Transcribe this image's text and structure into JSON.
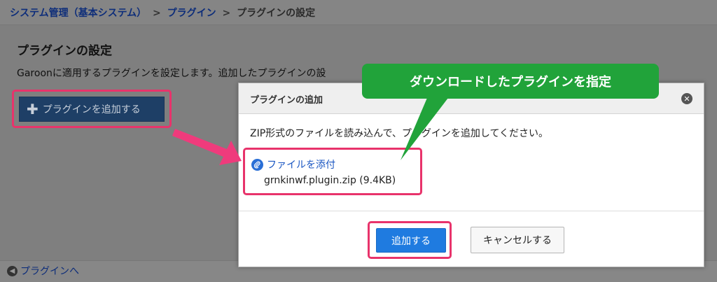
{
  "breadcrumb": {
    "item1": "システム管理（基本システム）",
    "sep": ">",
    "item2": "プラグイン",
    "current": "プラグインの設定"
  },
  "page": {
    "title": "プラグインの設定",
    "description": "Garoonに適用するプラグインを設定します。追加したプラグインの設",
    "add_button_label": "プラグインを追加する",
    "back_link_label": "プラグインへ"
  },
  "dialog": {
    "title": "プラグインの追加",
    "message": "ZIP形式のファイルを読み込んで、プラグインを追加してください。",
    "attach_label": "ファイルを添付",
    "file_name": "grnkinwf.plugin.zip (9.4KB)",
    "submit_label": "追加する",
    "cancel_label": "キャンセルする"
  },
  "annotation": {
    "callout_text": "ダウンロードしたプラグインを指定"
  },
  "colors": {
    "highlight": "#e8336b",
    "callout": "#21a33a",
    "primary": "#1f7be0"
  }
}
